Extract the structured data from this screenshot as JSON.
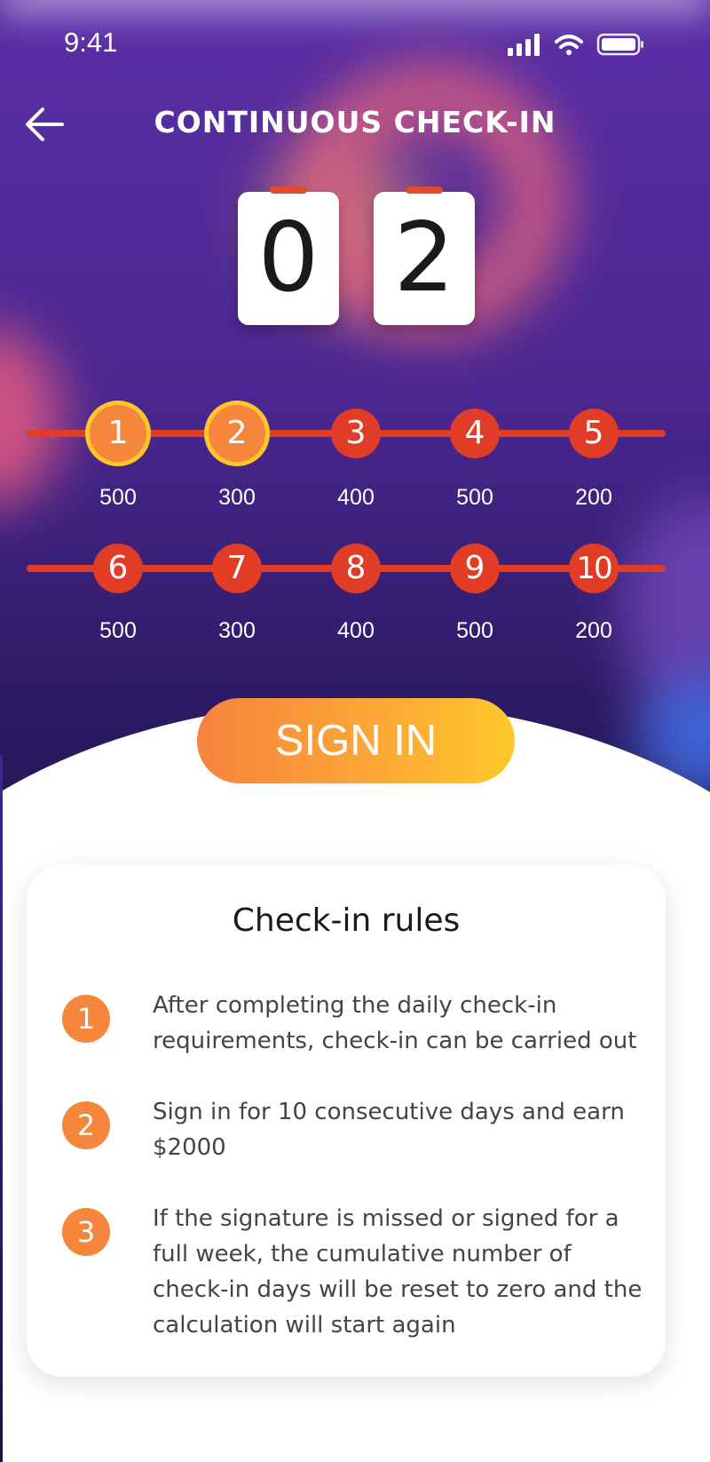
{
  "status_bar": {
    "time": "9:41"
  },
  "nav": {
    "title": "CONTINUOUS CHECK-IN"
  },
  "counter": {
    "digits": [
      "0",
      "2"
    ]
  },
  "days": [
    {
      "day": "1",
      "reward": "500",
      "checked": true
    },
    {
      "day": "2",
      "reward": "300",
      "checked": true
    },
    {
      "day": "3",
      "reward": "400",
      "checked": false
    },
    {
      "day": "4",
      "reward": "500",
      "checked": false
    },
    {
      "day": "5",
      "reward": "200",
      "checked": false
    },
    {
      "day": "6",
      "reward": "500",
      "checked": false
    },
    {
      "day": "7",
      "reward": "300",
      "checked": false
    },
    {
      "day": "8",
      "reward": "400",
      "checked": false
    },
    {
      "day": "9",
      "reward": "500",
      "checked": false
    },
    {
      "day": "10",
      "reward": "200",
      "checked": false
    }
  ],
  "sign_in_button": {
    "label": "SIGN IN"
  },
  "rules": {
    "title": "Check-in rules",
    "items": [
      {
        "number": "1",
        "text": "After completing the daily check-in requirements, check-in can be carried out"
      },
      {
        "number": "2",
        "text": "Sign in for 10 consecutive days and earn $2000"
      },
      {
        "number": "3",
        "text": "If the signature is missed or signed for a full week, the cumulative number of check-in days will be reset to zero and the calculation will start again"
      }
    ]
  },
  "colors": {
    "accent_orange": "#f5863c",
    "progress_red": "#e03c26",
    "highlight_yellow": "#ffc62b",
    "hero_purple": "#4a278f"
  }
}
